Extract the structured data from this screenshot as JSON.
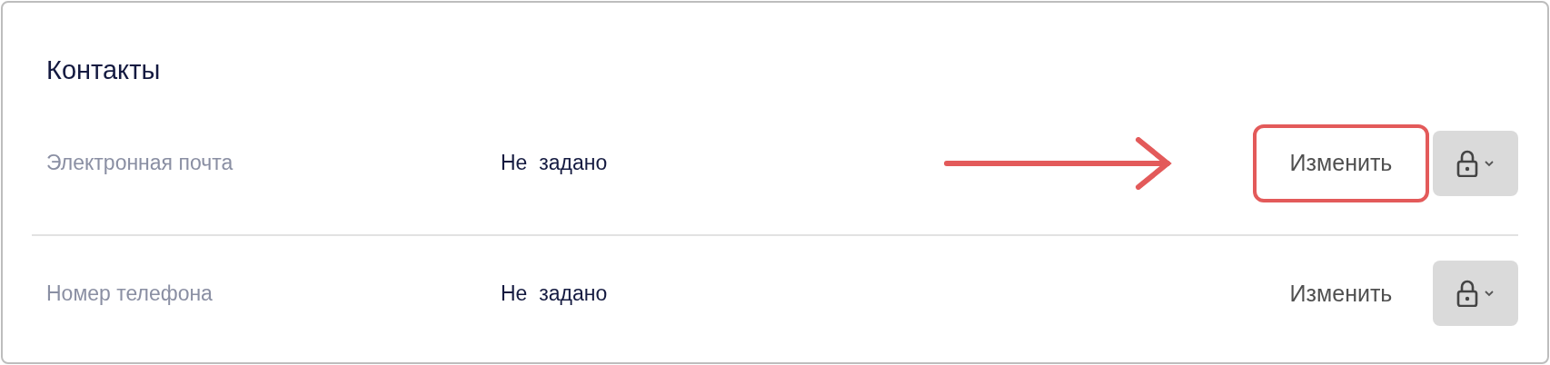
{
  "section": {
    "title": "Контакты"
  },
  "rows": [
    {
      "label": "Электронная почта",
      "value": "Не  задано",
      "action": "Изменить",
      "highlighted": true
    },
    {
      "label": "Номер телефона",
      "value": "Не  задано",
      "action": "Изменить",
      "highlighted": false
    }
  ]
}
